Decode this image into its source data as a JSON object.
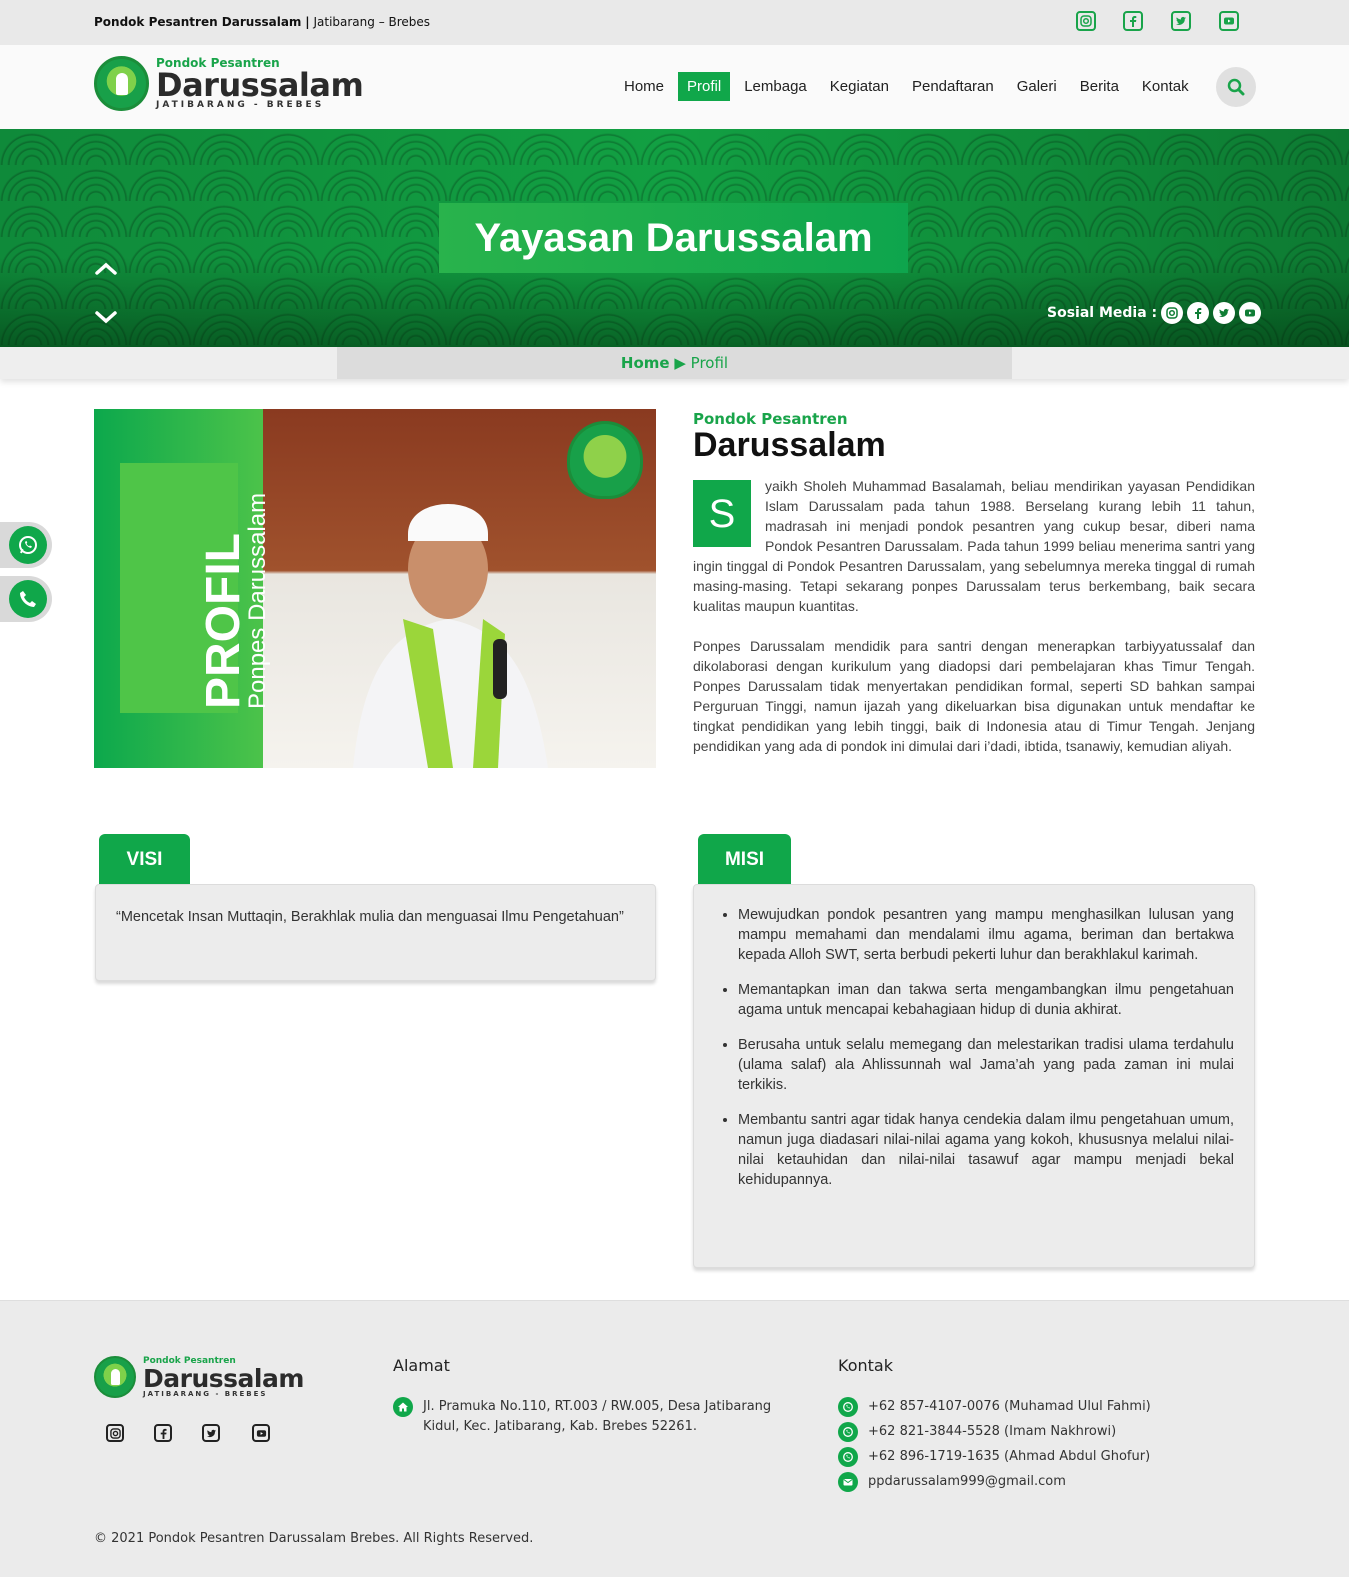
{
  "topbar": {
    "site_name": "Pondok Pesantren Darussalam",
    "separator": "|",
    "location": "Jatibarang – Brebes",
    "social_icons": [
      "instagram-icon",
      "facebook-icon",
      "twitter-icon",
      "youtube-icon"
    ]
  },
  "header": {
    "logo_small": "Pondok Pesantren",
    "logo_big": "Darussalam",
    "logo_sub": "JATIBARANG - BREBES",
    "nav": [
      "Home",
      "Profil",
      "Lembaga",
      "Kegiatan",
      "Pendaftaran",
      "Galeri",
      "Berita",
      "Kontak"
    ],
    "active_nav": "Profil"
  },
  "banner": {
    "title": "Yayasan Darussalam",
    "social_label": "Sosial Media :"
  },
  "breadcrumb": {
    "home": "Home",
    "separator": "▶",
    "current": "Profil"
  },
  "profile_image": {
    "text_big": "PROFIL",
    "text_small": "Ponpes Darussalam"
  },
  "about": {
    "kicker": "Pondok Pesantren",
    "title": "Darussalam",
    "dropcap": "S",
    "paragraph1": "yaikh Sholeh Muhammad Basalamah, beliau mendirikan yayasan Pendidikan Islam Darussalam pada tahun 1988. Berselang kurang lebih 11 tahun, madrasah ini menjadi pondok pesantren yang cukup besar, diberi nama Pondok Pesantren Darussalam. Pada tahun 1999 beliau menerima santri yang ingin tinggal di Pondok Pesantren Darussalam, yang sebelumnya mereka tinggal di rumah masing-masing. Tetapi sekarang ponpes Darussalam terus berkembang, baik secara kualitas maupun kuantitas.",
    "paragraph2": "Ponpes Darussalam mendidik para santri dengan menerapkan tarbiyyatussalaf dan dikolaborasi dengan kurikulum yang diadopsi dari pembelajaran khas Timur Tengah. Ponpes Darussalam tidak menyertakan pendidikan formal, seperti SD bahkan sampai Perguruan Tinggi, namun ijazah yang dikeluarkan bisa digunakan untuk mendaftar ke tingkat pendidikan yang lebih tinggi, baik di Indonesia atau di Timur Tengah. Jenjang pendidikan yang ada di pondok ini dimulai dari i’dadi, ibtida, tsanawiy, kemudian aliyah."
  },
  "visi": {
    "label": "VISI",
    "text": "“Mencetak Insan Muttaqin, Berakhlak mulia dan menguasai Ilmu Pengetahuan”"
  },
  "misi": {
    "label": "MISI",
    "items": [
      "Mewujudkan pondok pesantren yang mampu menghasilkan lulusan yang mampu memahami dan mendalami ilmu agama, beriman dan bertakwa kepada Alloh SWT, serta berbudi pekerti luhur dan berakhlakul karimah.",
      "Memantapkan iman dan takwa serta mengambangkan ilmu pengetahuan agama untuk mencapai kebahagiaan hidup di dunia akhirat.",
      "Berusaha untuk selalu memegang dan melestarikan tradisi ulama terdahulu (ulama salaf) ala Ahlissunnah wal Jama’ah yang pada zaman ini mulai terkikis.",
      "Membantu santri agar tidak hanya cendekia dalam ilmu pengetahuan umum, namun juga diadasari nilai-nilai agama yang kokoh, khususnya melalui nilai-nilai ketauhidan dan nilai-nilai tasawuf agar mampu menjadi bekal kehidupannya."
    ]
  },
  "footer": {
    "alamat_title": "Alamat",
    "alamat_text": "Jl. Pramuka No.110, RT.003 / RW.005, Desa Jatibarang Kidul, Kec. Jatibarang, Kab. Brebes 52261.",
    "kontak_title": "Kontak",
    "contacts": [
      "+62 857-4107-0076 (Muhamad Ulul Fahmi)",
      "+62 821-3844-5528 (Imam Nakhrowi)",
      "+62 896-1719-1635 (Ahmad Abdul Ghofur)",
      "ppdarussalam999@gmail.com"
    ],
    "copyright": "© 2021 Pondok Pesantren Darussalam Brebes. All Rights Reserved."
  },
  "colors": {
    "brand_green": "#10a74a",
    "dark_green": "#0e7d34",
    "topbar_bg": "#e9e9e9",
    "footer_bg": "#ebebeb"
  }
}
